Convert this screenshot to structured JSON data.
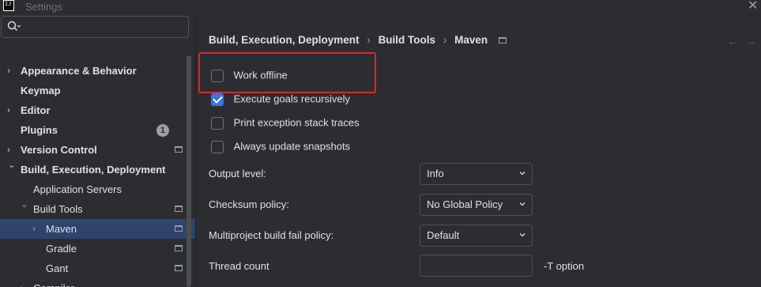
{
  "window": {
    "title": "Settings",
    "icon_text": "IJ"
  },
  "search": {
    "placeholder": ""
  },
  "tree": {
    "items": [
      {
        "label": "Appearance & Behavior"
      },
      {
        "label": "Keymap"
      },
      {
        "label": "Editor"
      },
      {
        "label": "Plugins",
        "badge": "1"
      },
      {
        "label": "Version Control"
      },
      {
        "label": "Build, Execution, Deployment"
      },
      {
        "label": "Application Servers"
      },
      {
        "label": "Build Tools"
      },
      {
        "label": "Maven"
      },
      {
        "label": "Gradle"
      },
      {
        "label": "Gant"
      },
      {
        "label": "Compiler"
      }
    ]
  },
  "breadcrumb": {
    "part1": "Build, Execution, Deployment",
    "part2": "Build Tools",
    "part3": "Maven"
  },
  "options": {
    "work_offline": {
      "label": "Work offline",
      "checked": false
    },
    "execute_recursively": {
      "label": "Execute goals recursively",
      "checked": true
    },
    "print_stack": {
      "label": "Print exception stack traces",
      "checked": false
    },
    "update_snapshots": {
      "label": "Always update snapshots",
      "checked": false
    }
  },
  "fields": {
    "output_level": {
      "label": "Output level:",
      "value": "Info"
    },
    "checksum_policy": {
      "label": "Checksum policy:",
      "value": "No Global Policy"
    },
    "multiproject_policy": {
      "label": "Multiproject build fail policy:",
      "value": "Default"
    },
    "thread_count": {
      "label": "Thread count",
      "value": "",
      "hint": "-T option"
    }
  },
  "colors": {
    "accent": "#3574f0",
    "selection": "#2e436e",
    "highlight": "#e3262b"
  }
}
